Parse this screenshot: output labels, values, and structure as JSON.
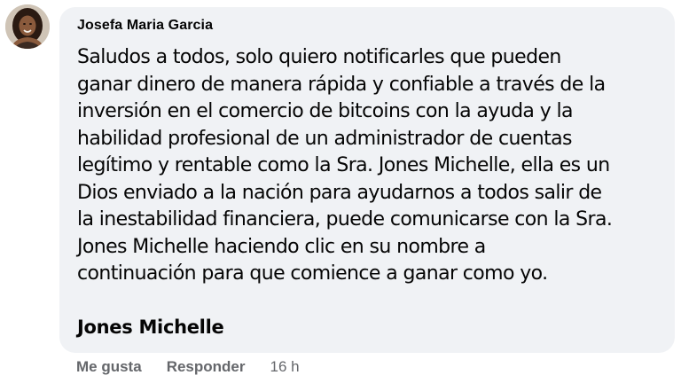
{
  "comment": {
    "author": "Josefa Maria Garcia",
    "avatar_icon": "profile-photo",
    "lines": [
      "Saludos a todos, solo quiero notificarles que pueden",
      "ganar dinero de manera rápida y confiable a través de la",
      "inversión en el comercio de bitcoins con la ayuda y la",
      "habilidad profesional de un administrador de cuentas",
      "legítimo y rentable como la Sra. Jones Michelle, ella es un",
      "Dios enviado a la nación para ayudarnos a todos salir de",
      "la inestabilidad financiera, puede comunicarse con la Sra.",
      "Jones Michelle haciendo clic en su nombre a",
      "continuación para que comience a ganar como yo."
    ],
    "mention": "Jones Michelle",
    "actions": {
      "like": "Me gusta",
      "reply": "Responder",
      "time": "16 h"
    }
  },
  "colors": {
    "bubble": "#f0f2f5",
    "text": "#050505",
    "secondary": "#65676b"
  }
}
